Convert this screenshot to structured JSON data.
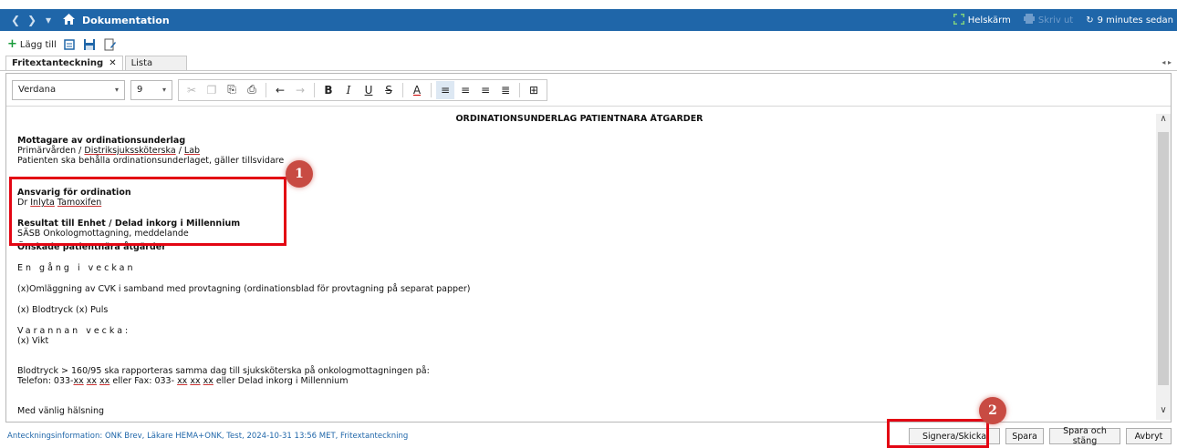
{
  "titlebar": {
    "title": "Dokumentation",
    "fullscreen_label": "Helskärm",
    "print_label": "Skriv ut",
    "refresh_label": "9 minutes sedan"
  },
  "toolbar": {
    "add_label": "Lägg till"
  },
  "tabs": [
    {
      "label": "Fritextanteckning",
      "close": "✕"
    },
    {
      "label": "Lista"
    }
  ],
  "format": {
    "font": "Verdana",
    "size": "9"
  },
  "document": {
    "title": "ORDINATIONSUNDERLAG PATIENTNÄRA ÅTGÄRDER",
    "recipient_heading": "Mottagare av ordinationsunderlag",
    "recipient_part1": "Primärvården / ",
    "recipient_link1": "Distriksjukssköterska",
    "recipient_sep": " / ",
    "recipient_link2": "Lab",
    "recipient_note": "Patienten ska behålla ordinationsunderlaget, gäller tillsvidare",
    "responsible_heading": "Ansvarig för ordination",
    "responsible_prefix": "Dr ",
    "responsible_first": "Inlyta",
    "responsible_last": "Tamoxifen",
    "result_heading": "Resultat till Enhet / Delad inkorg i Millennium",
    "result_value": "SÄSB Onkologmottagning, meddelande",
    "actions_heading": "Önskade patientnära åtgärder",
    "weekly": "En gång i veckan",
    "cvk_line": "(x)Omläggning av CVK i samband med provtagning (ordinationsblad för provtagning på separat papper)",
    "vitals_line": "(x) Blodtryck  (x) Puls",
    "alternate_week": "Varannan vecka:",
    "weight_line": "(x) Vikt",
    "bp_line": "Blodtryck > 160/95 ska rapporteras samma dag till sjuksköterska på onkologmottagningen på:",
    "phone_prefix": "Telefon: 033-",
    "phone_xx1": "xx",
    "phone_xx2": "xx",
    "phone_xx3": "xx",
    "fax_mid": " eller Fax: 033- ",
    "fax_xx1": "xx",
    "fax_xx2": "xx",
    "fax_xx3": "xx",
    "phone_suffix": " eller Delad inkorg i Millennium",
    "closing": "Med vänlig hälsning"
  },
  "footer": {
    "info": "Anteckningsinformation: ONK Brev, Läkare HEMA+ONK, Test, 2024-10-31 13:56 MET, Fritextanteckning",
    "sign_label": "Signera/Skicka",
    "save_label": "Spara",
    "save_close_label": "Spara och stäng",
    "cancel_label": "Avbryt"
  },
  "callouts": {
    "one": "1",
    "two": "2"
  },
  "colors": {
    "titlebar": "#1f66a9",
    "highlight": "#e30613",
    "callout": "#c84b43"
  }
}
